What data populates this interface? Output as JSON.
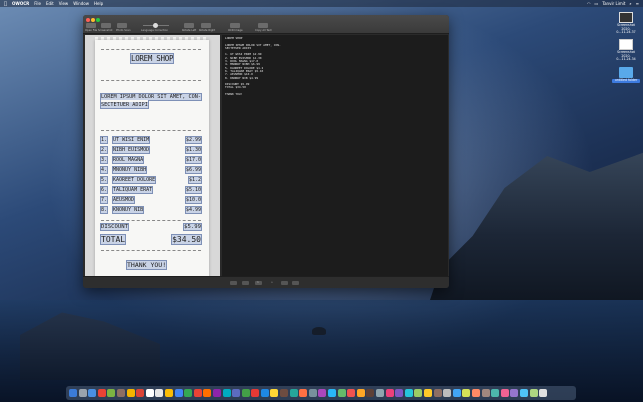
{
  "menubar": {
    "apple": "",
    "app_name": "OWOCR",
    "items": [
      "File",
      "Edit",
      "View",
      "Window",
      "Help"
    ],
    "user": "Tanvir Limit"
  },
  "desktop_icons": [
    {
      "label_1": "Screenshot",
      "label_2": "2020-0...11.24.37"
    },
    {
      "label_1": "Screenshot",
      "label_2": "2020-0...11.24.34"
    },
    {
      "label_1": "untitled folder",
      "label_2": ""
    }
  ],
  "toolbar": {
    "open_file": "Open File",
    "screenshot": "Screenshot",
    "photo_scan": "Photo Scan",
    "language_correction": "Language Correction",
    "rotate_left": "Rotate Left",
    "rotate_right": "Rotate Right",
    "ocr_image": "OCR Image",
    "copy_all_text": "Copy All Text"
  },
  "receipt": {
    "title": "LOREM SHOP",
    "subtitle": "LOREM IPSUM DOLOR SIT AMET, CON-SECTETUER ADIPI",
    "items": [
      {
        "num": "1.",
        "name": "UT WISI ENIM",
        "price": "$2.99"
      },
      {
        "num": "2.",
        "name": "NIBH EUISMOD",
        "price": "$1.30"
      },
      {
        "num": "3.",
        "name": "ROOL MAGNA",
        "price": "$17.0"
      },
      {
        "num": "4.",
        "name": "MNONUY NIBH",
        "price": "$6.99"
      },
      {
        "num": "5.",
        "name": "KAOREET DOLORE",
        "price": "$1.2"
      },
      {
        "num": "6.",
        "name": "TALIQUAM ERAT",
        "price": "$5.10"
      },
      {
        "num": "7.",
        "name": "AEUSMOD",
        "price": "$10.0"
      },
      {
        "num": "8.",
        "name": "KNONUY NIB",
        "price": "$4.99"
      }
    ],
    "discount_label": "DISCOUNT",
    "discount_value": "$5.99",
    "total_label": "TOTAL",
    "total_value": "$34.50",
    "thanks": "THANK YOU!"
  },
  "ocr_output": "LOREM SHOP\n\nLOREM IPSUM DOLOR SIT AMET, CON-\nSECTETUER ADIPI\n\n1. UT WISI ENIM $2.99\n2. NIBH EUISMOD $1.30\n3. ROOL MAGNA $17.0\n4. MNONUY NIBH $6.99\n5. KAOREET DOLORE $1.2\n6. TALIQUAM ERAT $5.10\n7. AEUSMOD $10.0\n8. KNONUY NIB $4.99\n\nDISCOUNT $5.99\nTOTAL $34.50\n\nTHANK YOU!",
  "bottombar": {
    "page_indicator": "1"
  },
  "dock_colors": [
    "#3b7bd8",
    "#9aa3ad",
    "#4a90e2",
    "#e94335",
    "#7cb342",
    "#8d6e63",
    "#f4b400",
    "#db4437",
    "#ffffff",
    "#e6e6e6",
    "#fbbc05",
    "#4285f4",
    "#34a853",
    "#ea4335",
    "#ff6f00",
    "#8e24aa",
    "#00acc1",
    "#5c6bc0",
    "#43a047",
    "#e53935",
    "#1e88e5",
    "#fdd835",
    "#6d4c41",
    "#26a69a",
    "#ff7043",
    "#78909c",
    "#ab47bc",
    "#29b6f6",
    "#66bb6a",
    "#ef5350",
    "#ffa726",
    "#5d4037",
    "#90a4ae",
    "#ec407a",
    "#7e57c2",
    "#26c6da",
    "#9ccc65",
    "#ffca28",
    "#8d6e63",
    "#bdbdbd",
    "#42a5f5",
    "#d4e157",
    "#ff8a65",
    "#a1887f",
    "#4db6ac",
    "#f06292",
    "#9575cd",
    "#4fc3f7",
    "#aed581",
    "#e0e0e0"
  ]
}
